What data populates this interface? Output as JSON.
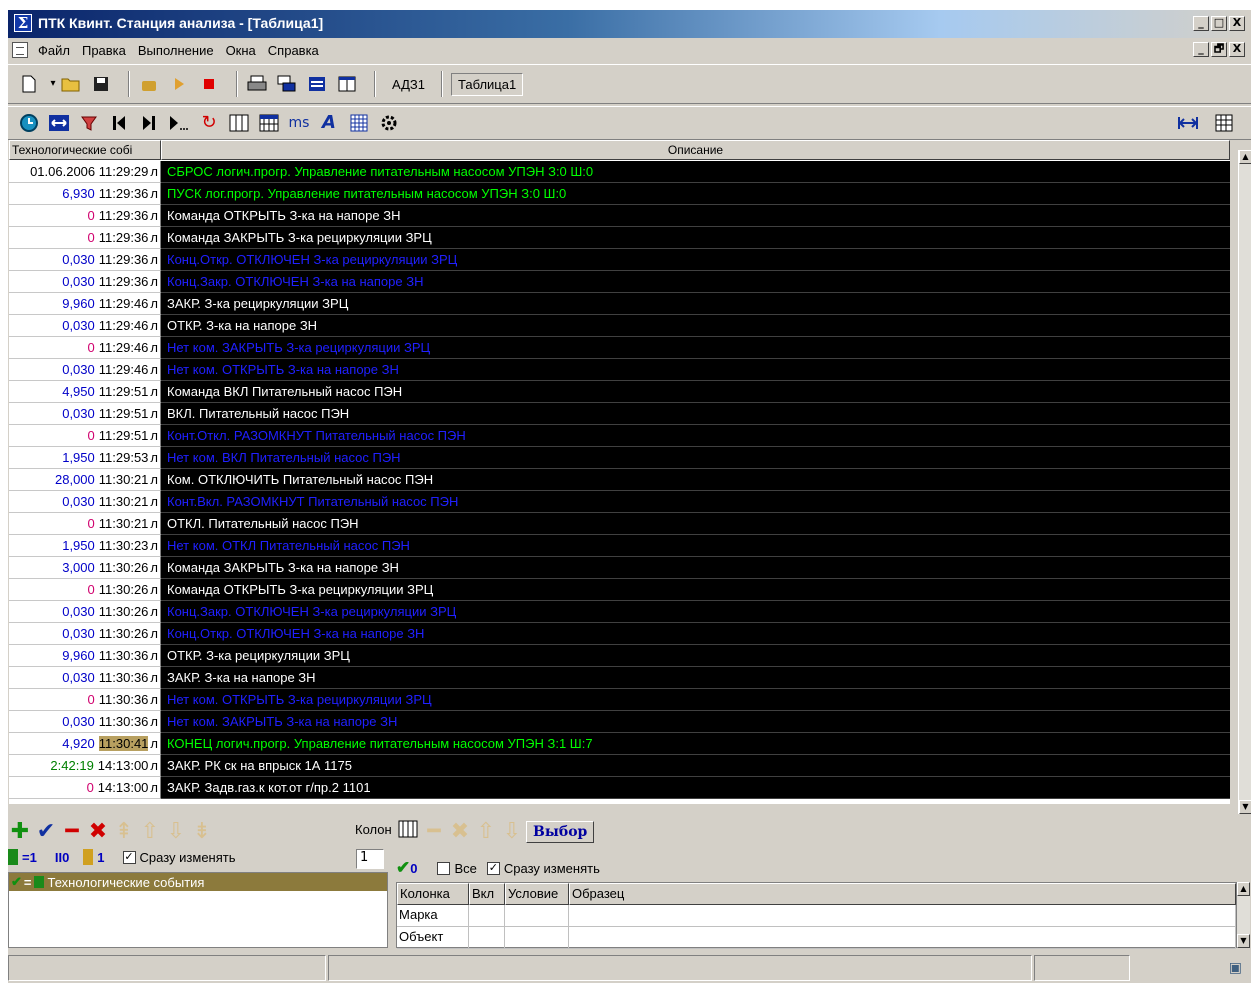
{
  "window": {
    "title": "ПТК Квинт. Станция анализа - [Таблица1]",
    "controls": [
      "_",
      "□",
      "X"
    ],
    "mdi_controls": [
      "_",
      "🗗",
      "X"
    ]
  },
  "menu": [
    "Файл",
    "Правка",
    "Выполнение",
    "Окна",
    "Справка"
  ],
  "toolbar1": {
    "icons": [
      "new-icon",
      "dropdown-arrow-icon",
      "open-folder-icon",
      "save-icon",
      "hand-icon",
      "play-icon",
      "stop-icon",
      "print-icon",
      "windows-cascade-icon",
      "table-rows-icon",
      "table-columns-icon"
    ],
    "ad31_label": "АДЗ1",
    "table_tab_label": "Таблица1"
  },
  "toolbar2": {
    "icons": [
      "clock-icon",
      "fit-width-icon",
      "filter-icon",
      "first-icon",
      "last-icon",
      "play-to-icon",
      "refresh-icon",
      "columns-icon",
      "calendar-icon",
      "ms-icon",
      "format-icon",
      "settings-grid-icon",
      "gear-icon"
    ],
    "ms_label": "ms"
  },
  "grid": {
    "col1_header": "Технологические собі",
    "col2_header": "Описание",
    "rows": [
      {
        "num": "",
        "num_color": "none",
        "time": "01.06.2006 11:29:29",
        "tail": "л",
        "desc": "СБРОС логич.прогр. Управление питательным насосом УПЭН  З:0 Ш:0",
        "color": "green",
        "hl": false
      },
      {
        "num": "6,930",
        "num_color": "blue",
        "time": "11:29:36",
        "tail": "л",
        "desc": "ПУСК лог.прогр. Управление питательным насосом УПЭН  З:0 Ш:0",
        "color": "green",
        "hl": false
      },
      {
        "num": "0",
        "num_color": "pink",
        "time": "11:29:36",
        "tail": "л",
        "desc": "Команда ОТКРЫТЬ З-ка на напоре ЗН",
        "color": "white",
        "hl": false
      },
      {
        "num": "0",
        "num_color": "pink",
        "time": "11:29:36",
        "tail": "л",
        "desc": "Команда ЗАКРЫТЬ З-ка рециркуляции ЗРЦ",
        "color": "white",
        "hl": false
      },
      {
        "num": "0,030",
        "num_color": "blue",
        "time": "11:29:36",
        "tail": "л",
        "desc": "Конц.Откр. ОТКЛЮЧЕН З-ка рециркуляции ЗРЦ",
        "color": "blue",
        "hl": false
      },
      {
        "num": "0,030",
        "num_color": "blue",
        "time": "11:29:36",
        "tail": "л",
        "desc": "Конц.Закр. ОТКЛЮЧЕН З-ка на напоре ЗН",
        "color": "blue",
        "hl": false
      },
      {
        "num": "9,960",
        "num_color": "blue",
        "time": "11:29:46",
        "tail": "л",
        "desc": "ЗАКР. З-ка рециркуляции ЗРЦ",
        "color": "white",
        "hl": false
      },
      {
        "num": "0,030",
        "num_color": "blue",
        "time": "11:29:46",
        "tail": "л",
        "desc": "ОТКР. З-ка на напоре ЗН",
        "color": "white",
        "hl": false
      },
      {
        "num": "0",
        "num_color": "pink",
        "time": "11:29:46",
        "tail": "л",
        "desc": "Нет ком. ЗАКРЫТЬ З-ка рециркуляции ЗРЦ",
        "color": "blue",
        "hl": false
      },
      {
        "num": "0,030",
        "num_color": "blue",
        "time": "11:29:46",
        "tail": "л",
        "desc": "Нет ком. ОТКРЫТЬ З-ка на напоре ЗН",
        "color": "blue",
        "hl": false
      },
      {
        "num": "4,950",
        "num_color": "blue",
        "time": "11:29:51",
        "tail": "л",
        "desc": "Команда ВКЛ Питательный насос ПЭН",
        "color": "white",
        "hl": false
      },
      {
        "num": "0,030",
        "num_color": "blue",
        "time": "11:29:51",
        "tail": "л",
        "desc": "ВКЛ. Питательный насос ПЭН",
        "color": "white",
        "hl": false
      },
      {
        "num": "0",
        "num_color": "pink",
        "time": "11:29:51",
        "tail": "л",
        "desc": "Конт.Откл. РАЗОМКНУТ Питательный насос ПЭН",
        "color": "blue",
        "hl": false
      },
      {
        "num": "1,950",
        "num_color": "blue",
        "time": "11:29:53",
        "tail": "л",
        "desc": "Нет ком. ВКЛ Питательный насос ПЭН",
        "color": "blue",
        "hl": false
      },
      {
        "num": "28,000",
        "num_color": "blue",
        "time": "11:30:21",
        "tail": "л",
        "desc": "Ком. ОТКЛЮЧИТЬ Питательный насос ПЭН",
        "color": "white",
        "hl": false
      },
      {
        "num": "0,030",
        "num_color": "blue",
        "time": "11:30:21",
        "tail": "л",
        "desc": "Конт.Вкл. РАЗОМКНУТ Питательный насос ПЭН",
        "color": "blue",
        "hl": false
      },
      {
        "num": "0",
        "num_color": "pink",
        "time": "11:30:21",
        "tail": "л",
        "desc": "ОТКЛ. Питательный насос ПЭН",
        "color": "white",
        "hl": false
      },
      {
        "num": "1,950",
        "num_color": "blue",
        "time": "11:30:23",
        "tail": "л",
        "desc": "Нет ком. ОТКЛ Питательный насос ПЭН",
        "color": "blue",
        "hl": false
      },
      {
        "num": "3,000",
        "num_color": "blue",
        "time": "11:30:26",
        "tail": "л",
        "desc": "Команда ЗАКРЫТЬ З-ка на напоре ЗН",
        "color": "white",
        "hl": false
      },
      {
        "num": "0",
        "num_color": "pink",
        "time": "11:30:26",
        "tail": "л",
        "desc": "Команда ОТКРЫТЬ З-ка рециркуляции ЗРЦ",
        "color": "white",
        "hl": false
      },
      {
        "num": "0,030",
        "num_color": "blue",
        "time": "11:30:26",
        "tail": "л",
        "desc": "Конц.Закр. ОТКЛЮЧЕН З-ка рециркуляции ЗРЦ",
        "color": "blue",
        "hl": false
      },
      {
        "num": "0,030",
        "num_color": "blue",
        "time": "11:30:26",
        "tail": "л",
        "desc": "Конц.Откр. ОТКЛЮЧЕН З-ка на напоре ЗН",
        "color": "blue",
        "hl": false
      },
      {
        "num": "9,960",
        "num_color": "blue",
        "time": "11:30:36",
        "tail": "л",
        "desc": "ОТКР. З-ка рециркуляции ЗРЦ",
        "color": "white",
        "hl": false
      },
      {
        "num": "0,030",
        "num_color": "blue",
        "time": "11:30:36",
        "tail": "л",
        "desc": "ЗАКР. З-ка на напоре ЗН",
        "color": "white",
        "hl": false
      },
      {
        "num": "0",
        "num_color": "pink",
        "time": "11:30:36",
        "tail": "л",
        "desc": "Нет ком. ОТКРЫТЬ З-ка рециркуляции ЗРЦ",
        "color": "blue",
        "hl": false
      },
      {
        "num": "0,030",
        "num_color": "blue",
        "time": "11:30:36",
        "tail": "л",
        "desc": "Нет ком. ЗАКРЫТЬ З-ка на напоре ЗН",
        "color": "blue",
        "hl": false
      },
      {
        "num": "4,920",
        "num_color": "blue",
        "time": "11:30:41",
        "tail": "л",
        "desc": "КОНЕЦ логич.прогр. Управление питательным насосом УПЭН  З:1 Ш:7",
        "color": "green",
        "hl": true
      },
      {
        "num": "2:42:19",
        "num_color": "green",
        "time": "14:13:00",
        "tail": "л",
        "desc": "ЗАКР. РК ск на впрыск 1А 1175",
        "color": "white",
        "hl": false
      },
      {
        "num": "0",
        "num_color": "pink",
        "time": "14:13:00",
        "tail": "л",
        "desc": "ЗАКР. Задв.газ.к кот.от г/пр.2 1101",
        "color": "white",
        "hl": false
      }
    ]
  },
  "bottom_left": {
    "icons": [
      "add-icon",
      "check-icon",
      "minus-icon",
      "delete-icon",
      "move-top-icon",
      "move-up-icon",
      "move-down-icon",
      "move-bottom-icon"
    ],
    "eq_label": "=1",
    "zero_label": "0",
    "one_label": "1",
    "instant_change_label": "Сразу изменять",
    "instant_change_checked": true,
    "tree_item_label": "Технологические события"
  },
  "bottom_right": {
    "kolo_label": "Колон",
    "spin_value": "1",
    "vybor_label": "Выбор",
    "zero_label": "0",
    "all_label": "Все",
    "all_checked": false,
    "instant_change_label": "Сразу изменять",
    "instant_change_checked": true,
    "table_headers": [
      "Колонка",
      "Вкл",
      "Условие",
      "Образец"
    ],
    "table_rows": [
      "Марка",
      "Объект"
    ]
  }
}
